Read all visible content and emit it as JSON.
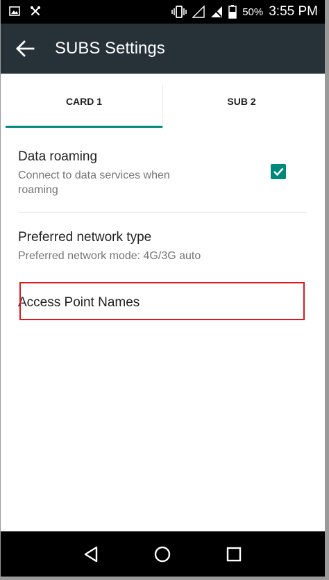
{
  "status_bar": {
    "icons": [
      "image-icon",
      "crossed-tool-icon",
      "vibrate-icon",
      "signal-icon",
      "no-sim-icon",
      "battery-icon"
    ],
    "battery": "50%",
    "time": "3:55 PM"
  },
  "toolbar": {
    "back_icon": "arrow-left-icon",
    "title": "SUBS Settings",
    "background": "#263238"
  },
  "tabs": [
    {
      "label": "CARD 1",
      "selected": true
    },
    {
      "label": "SUB 2",
      "selected": false
    }
  ],
  "accent_color": "#00897b",
  "preferences": {
    "data_roaming": {
      "title": "Data roaming",
      "summary_line1": "Connect to data services when",
      "summary_line2": "roaming",
      "checked": true
    },
    "network_type": {
      "title": "Preferred network type",
      "summary": "Preferred network mode: 4G/3G auto"
    },
    "apn": {
      "title": "Access Point Names"
    }
  },
  "highlight_color": "#e0161c",
  "nav_bar": {
    "icons": [
      "back-triangle-icon",
      "home-circle-icon",
      "recents-square-icon"
    ]
  }
}
